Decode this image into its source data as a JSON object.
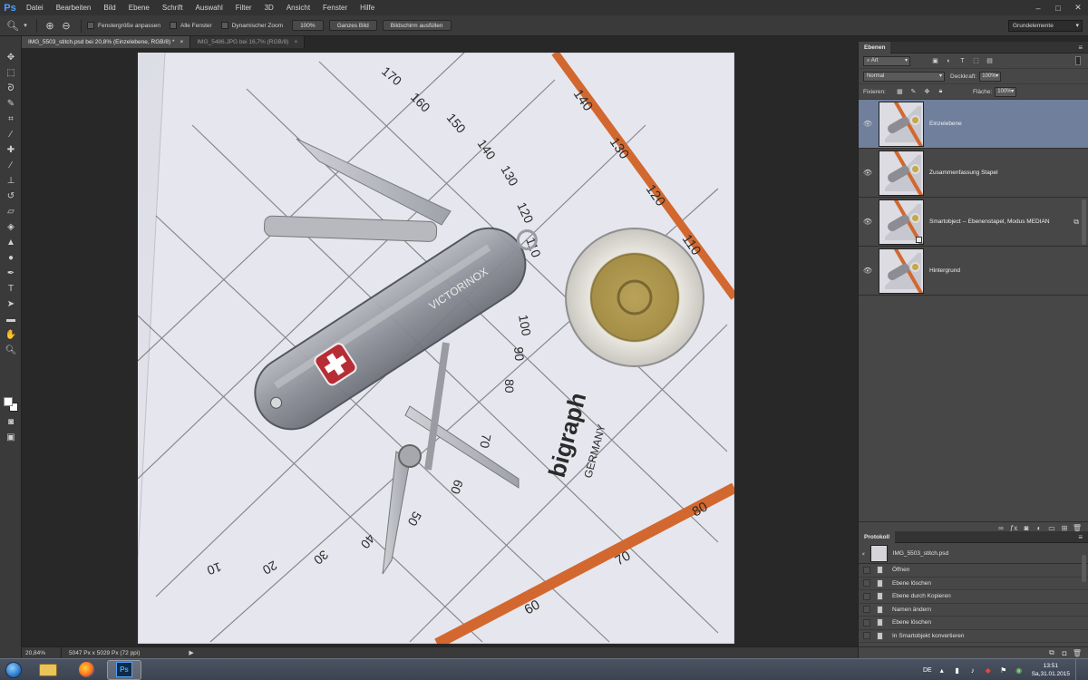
{
  "app": {
    "logo": "Ps"
  },
  "menu": [
    "Datei",
    "Bearbeiten",
    "Bild",
    "Ebene",
    "Schrift",
    "Auswahl",
    "Filter",
    "3D",
    "Ansicht",
    "Fenster",
    "Hilfe"
  ],
  "window_controls": {
    "minimize": "–",
    "maximize": "□",
    "close": "✕"
  },
  "options": {
    "fit_window": "Fenstergröße anpassen",
    "all_windows": "Alle Fenster",
    "scrubby_zoom": "Dynamischer Zoom",
    "btn_100": "100%",
    "btn_fit_screen": "Ganzes Bild",
    "btn_fill_screen": "Bildschirm ausfüllen",
    "workspace": "Grundelemente"
  },
  "tabs": [
    {
      "label": "IMG_5503_stitch.psd bei 20,8% (Einzelebene, RGB/8) *",
      "close": "×"
    },
    {
      "label": "IMG_5486.JPG bei 16,7% (RGB/8)",
      "close": "×"
    }
  ],
  "status": {
    "zoom": "20,84%",
    "doc_info": "5047 Px x 5029 Px (72 ppi)",
    "arrow": "▶"
  },
  "layers_panel": {
    "tab": "Ebenen",
    "filter_kind": "Art",
    "blend_mode": "Normal",
    "opacity_label": "Deckkraft:",
    "opacity_value": "100%",
    "lock_label": "Fixieren:",
    "fill_label": "Fläche:",
    "fill_value": "100%",
    "layers": [
      {
        "name": "Einzelebene",
        "selected": true
      },
      {
        "name": "Zusammenfassung Stapel",
        "selected": false
      },
      {
        "name": "Smartobject -- Ebenenstapel, Modus MEDIAN",
        "selected": false
      },
      {
        "name": "Hintergrund",
        "selected": false
      }
    ]
  },
  "history_panel": {
    "tab": "Protokoll",
    "snapshot": "IMG_5503_stitch.psd",
    "steps": [
      "Öffnen",
      "Ebene löschen",
      "Ebene durch Kopieren",
      "Namen ändern",
      "Ebene löschen",
      "In Smartobjekt konvertieren"
    ]
  },
  "taskbar": {
    "language": "DE",
    "time": "13:51",
    "date": "Sa,31.01.2015"
  },
  "photo": {
    "ruler_numbers": [
      "170",
      "160",
      "150",
      "140",
      "130",
      "120",
      "110",
      "100",
      "90",
      "80",
      "70",
      "60",
      "50",
      "40",
      "30",
      "20",
      "10"
    ],
    "brand": "bigraph",
    "country": "GERMANY",
    "knife_brand": "VICTORINOX",
    "stripe_labels": [
      "140",
      "130",
      "120",
      "110",
      "80",
      "70",
      "60"
    ]
  }
}
